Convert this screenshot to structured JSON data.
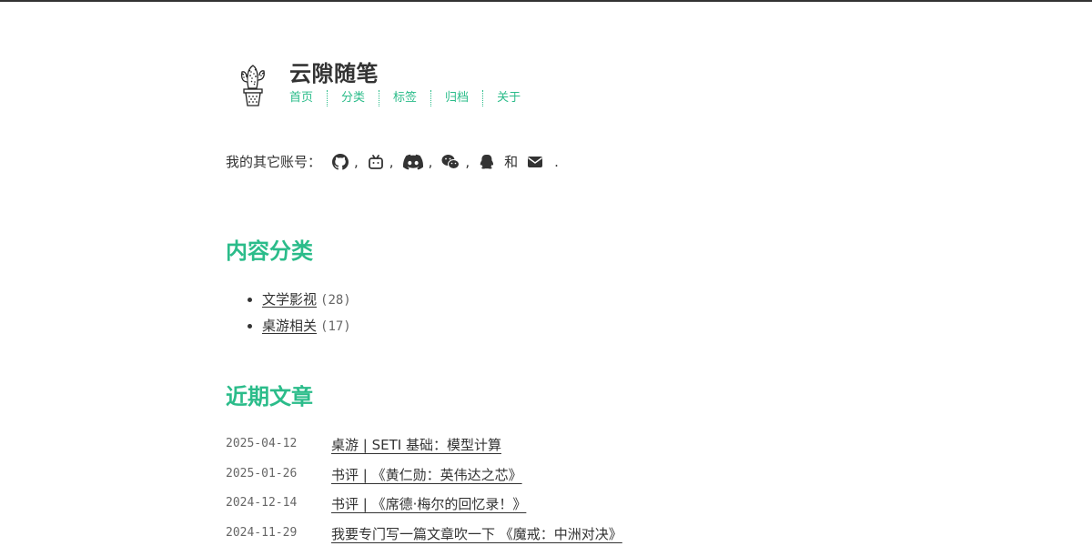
{
  "site": {
    "title": "云隙随笔",
    "nav": [
      "首页",
      "分类",
      "标签",
      "归档",
      "关于"
    ]
  },
  "accounts": {
    "prefix": "我的其它账号：",
    "sep": ",",
    "and": "和",
    "end": ".",
    "icons": [
      "github-icon",
      "bilibili-icon",
      "discord-icon",
      "wechat-icon",
      "qq-icon",
      "email-icon"
    ]
  },
  "categories": {
    "heading": "内容分类",
    "items": [
      {
        "name": "文学影视",
        "count": "(28)"
      },
      {
        "name": "桌游相关",
        "count": "(17)"
      }
    ]
  },
  "recent": {
    "heading": "近期文章",
    "posts": [
      {
        "date": "2025-04-12",
        "title": "桌游 | SETI 基础：模型计算"
      },
      {
        "date": "2025-01-26",
        "title": "书评 | 《黄仁勋：英伟达之芯》"
      },
      {
        "date": "2024-12-14",
        "title": "书评 | 《席德·梅尔的回忆录！》"
      },
      {
        "date": "2024-11-29",
        "title": "我要专门写一篇文章吹一下 《魔戒：中洲对决》"
      }
    ]
  },
  "colors": {
    "accent": "#2bbc8a",
    "text": "#333333"
  }
}
